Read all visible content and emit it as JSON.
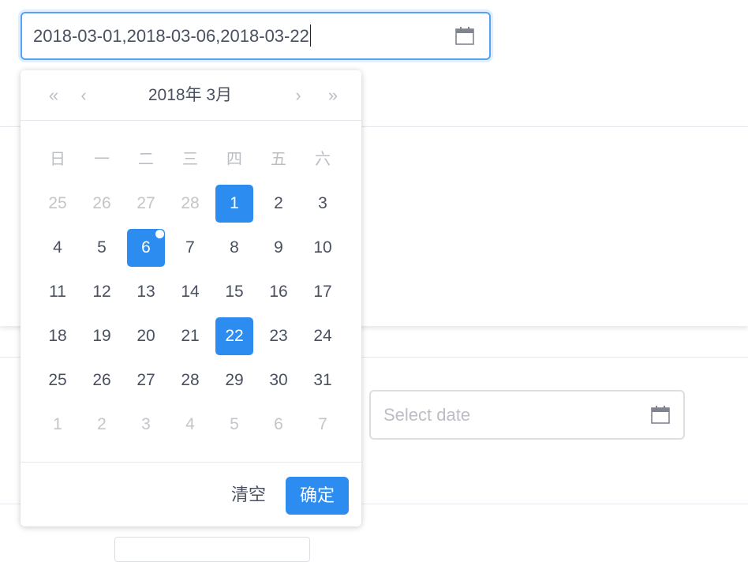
{
  "main_input": {
    "value": "2018-03-01,2018-03-06,2018-03-22",
    "icon": "calendar-icon"
  },
  "second_input": {
    "placeholder": "Select date",
    "icon": "calendar-icon"
  },
  "picker": {
    "title": "2018年 3月",
    "nav": {
      "prev_year": "«",
      "prev_month": "‹",
      "next_month": "›",
      "next_year": "»"
    },
    "weekdays": [
      "日",
      "一",
      "二",
      "三",
      "四",
      "五",
      "六"
    ],
    "weeks": [
      [
        {
          "label": "25",
          "other": true
        },
        {
          "label": "26",
          "other": true
        },
        {
          "label": "27",
          "other": true
        },
        {
          "label": "28",
          "other": true
        },
        {
          "label": "1",
          "selected": true
        },
        {
          "label": "2"
        },
        {
          "label": "3"
        }
      ],
      [
        {
          "label": "4"
        },
        {
          "label": "5"
        },
        {
          "label": "6",
          "selected": true,
          "today": true
        },
        {
          "label": "7"
        },
        {
          "label": "8"
        },
        {
          "label": "9"
        },
        {
          "label": "10"
        }
      ],
      [
        {
          "label": "11"
        },
        {
          "label": "12"
        },
        {
          "label": "13"
        },
        {
          "label": "14"
        },
        {
          "label": "15"
        },
        {
          "label": "16"
        },
        {
          "label": "17"
        }
      ],
      [
        {
          "label": "18"
        },
        {
          "label": "19"
        },
        {
          "label": "20"
        },
        {
          "label": "21"
        },
        {
          "label": "22",
          "selected": true
        },
        {
          "label": "23"
        },
        {
          "label": "24"
        }
      ],
      [
        {
          "label": "25"
        },
        {
          "label": "26"
        },
        {
          "label": "27"
        },
        {
          "label": "28"
        },
        {
          "label": "29"
        },
        {
          "label": "30"
        },
        {
          "label": "31"
        }
      ],
      [
        {
          "label": "1",
          "other": true
        },
        {
          "label": "2",
          "other": true
        },
        {
          "label": "3",
          "other": true
        },
        {
          "label": "4",
          "other": true
        },
        {
          "label": "5",
          "other": true
        },
        {
          "label": "6",
          "other": true
        },
        {
          "label": "7",
          "other": true
        }
      ]
    ],
    "footer": {
      "clear_label": "清空",
      "ok_label": "确定"
    }
  },
  "colors": {
    "accent": "#2d8cf0",
    "text": "#495060",
    "muted": "#c3c5ca",
    "border": "#dddee1"
  }
}
